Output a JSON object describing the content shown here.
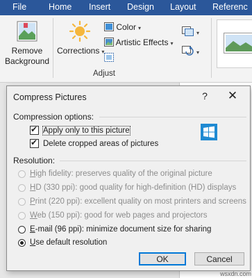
{
  "ribbon_tabs": [
    "File",
    "Home",
    "Insert",
    "Design",
    "Layout",
    "Referenc"
  ],
  "ribbon": {
    "remove_background": [
      "Remove",
      "Background"
    ],
    "corrections": "Corrections",
    "color": "Color",
    "artistic_effects": "Artistic Effects",
    "group_label": "Adjust"
  },
  "dialog": {
    "title": "Compress Pictures",
    "help": "?",
    "close": "✕",
    "compression_label": "Compression options:",
    "apply_only": "Apply only to this picture",
    "apply_only_checked": true,
    "delete_cropped": "Delete cropped areas of pictures",
    "delete_cropped_checked": true,
    "resolution_label": "Resolution:",
    "resolutions": [
      {
        "mnemonic": "H",
        "rest": "igh fidelity: preserves quality of the original picture",
        "enabled": false,
        "selected": false
      },
      {
        "mnemonic": "H",
        "rest": "D (330 ppi): good quality for high-definition (HD) displays",
        "enabled": false,
        "selected": false
      },
      {
        "mnemonic": "P",
        "rest": "rint (220 ppi): excellent quality on most printers and screens",
        "enabled": false,
        "selected": false
      },
      {
        "mnemonic": "W",
        "rest": "eb (150 ppi): good for web pages and projectors",
        "enabled": false,
        "selected": false
      },
      {
        "mnemonic": "E",
        "rest": "-mail (96 ppi): minimize document size for sharing",
        "enabled": true,
        "selected": false
      },
      {
        "mnemonic": "U",
        "rest": "se default resolution",
        "enabled": true,
        "selected": true
      }
    ],
    "ok": "OK",
    "cancel": "Cancel"
  },
  "watermark": "wsxdn.com",
  "colors": {
    "ribbon_tab_bar": "#2b579a",
    "dialog_bg": "#f0f0f0",
    "primary_button_border": "#0078d7",
    "windows_logo": "#1f8ad2"
  }
}
